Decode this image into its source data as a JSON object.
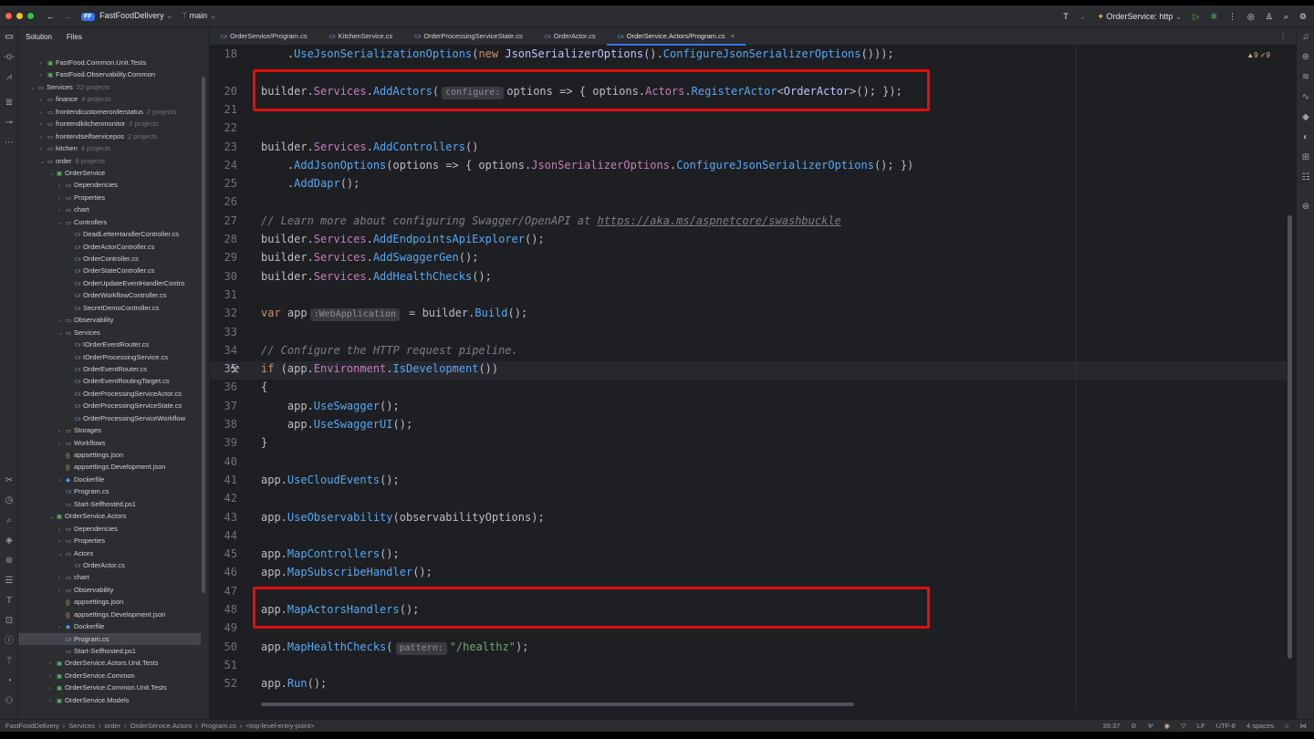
{
  "titlebar": {
    "project_badge": "FF",
    "project_name": "FastFoodDelivery",
    "branch": "main",
    "run_config": "OrderService: http"
  },
  "project_panel": {
    "tabs": [
      "Solution",
      "Files"
    ],
    "rows": [
      {
        "indent": 2,
        "chev": "›",
        "icon": "proj",
        "label": "FastFood.Common.Unit.Tests",
        "meta": ""
      },
      {
        "indent": 2,
        "chev": "›",
        "icon": "proj",
        "label": "FastFood.Observability.Common",
        "meta": ""
      },
      {
        "indent": 1,
        "chev": "⌄",
        "icon": "folder",
        "label": "Services",
        "meta": "22 projects"
      },
      {
        "indent": 2,
        "chev": "›",
        "icon": "folder",
        "label": "finance",
        "meta": "4 projects"
      },
      {
        "indent": 2,
        "chev": "›",
        "icon": "folder",
        "label": "frontendcustomerorderstatus",
        "meta": "2 projects"
      },
      {
        "indent": 2,
        "chev": "›",
        "icon": "folder",
        "label": "frontendkitchenmonitor",
        "meta": "2 projects"
      },
      {
        "indent": 2,
        "chev": "›",
        "icon": "folder",
        "label": "frontendselfservicepos",
        "meta": "2 projects"
      },
      {
        "indent": 2,
        "chev": "›",
        "icon": "folder",
        "label": "kitchen",
        "meta": "4 projects"
      },
      {
        "indent": 2,
        "chev": "⌄",
        "icon": "folder",
        "label": "order",
        "meta": "8 projects"
      },
      {
        "indent": 3,
        "chev": "⌄",
        "icon": "proj",
        "label": "OrderService",
        "meta": ""
      },
      {
        "indent": 4,
        "chev": "›",
        "icon": "folder",
        "label": "Dependencies",
        "meta": ""
      },
      {
        "indent": 4,
        "chev": "›",
        "icon": "folder",
        "label": "Properties",
        "meta": ""
      },
      {
        "indent": 4,
        "chev": "›",
        "icon": "folder",
        "label": "chart",
        "meta": ""
      },
      {
        "indent": 4,
        "chev": "⌄",
        "icon": "folder",
        "label": "Controllers",
        "meta": ""
      },
      {
        "indent": 5,
        "chev": "",
        "icon": "cs",
        "label": "DeadLetterHandlerController.cs",
        "meta": ""
      },
      {
        "indent": 5,
        "chev": "",
        "icon": "cs",
        "label": "OrderActorController.cs",
        "meta": ""
      },
      {
        "indent": 5,
        "chev": "",
        "icon": "cs",
        "label": "OrderController.cs",
        "meta": ""
      },
      {
        "indent": 5,
        "chev": "",
        "icon": "cs",
        "label": "OrderStateController.cs",
        "meta": ""
      },
      {
        "indent": 5,
        "chev": "",
        "icon": "cs",
        "label": "OrderUpdateEventHandlerContro",
        "meta": ""
      },
      {
        "indent": 5,
        "chev": "",
        "icon": "cs",
        "label": "OrderWorkflowController.cs",
        "meta": ""
      },
      {
        "indent": 5,
        "chev": "",
        "icon": "cs",
        "label": "SecretDemoController.cs",
        "meta": ""
      },
      {
        "indent": 4,
        "chev": "›",
        "icon": "folder",
        "label": "Observability",
        "meta": ""
      },
      {
        "indent": 4,
        "chev": "⌄",
        "icon": "folder",
        "label": "Services",
        "meta": ""
      },
      {
        "indent": 5,
        "chev": "",
        "icon": "cs",
        "label": "IOrderEventRouter.cs",
        "meta": ""
      },
      {
        "indent": 5,
        "chev": "",
        "icon": "cs",
        "label": "IOrderProcessingService.cs",
        "meta": ""
      },
      {
        "indent": 5,
        "chev": "",
        "icon": "cs",
        "label": "OrderEventRouter.cs",
        "meta": ""
      },
      {
        "indent": 5,
        "chev": "",
        "icon": "cs",
        "label": "OrderEventRoutingTarget.cs",
        "meta": ""
      },
      {
        "indent": 5,
        "chev": "",
        "icon": "cs",
        "label": "OrderProcessingServiceActor.cs",
        "meta": ""
      },
      {
        "indent": 5,
        "chev": "",
        "icon": "cs",
        "label": "OrderProcessingServiceState.cs",
        "meta": ""
      },
      {
        "indent": 5,
        "chev": "",
        "icon": "cs",
        "label": "OrderProcessingServiceWorkflow",
        "meta": ""
      },
      {
        "indent": 4,
        "chev": "›",
        "icon": "folder",
        "label": "Storages",
        "meta": ""
      },
      {
        "indent": 4,
        "chev": "›",
        "icon": "folder",
        "label": "Workflows",
        "meta": ""
      },
      {
        "indent": 4,
        "chev": "",
        "icon": "json",
        "label": "appsettings.json",
        "meta": ""
      },
      {
        "indent": 4,
        "chev": "",
        "icon": "json",
        "label": "appsettings.Development.json",
        "meta": ""
      },
      {
        "indent": 4,
        "chev": "›",
        "icon": "docker",
        "label": "Dockerfile",
        "meta": ""
      },
      {
        "indent": 4,
        "chev": "",
        "icon": "cs",
        "label": "Program.cs",
        "meta": ""
      },
      {
        "indent": 4,
        "chev": "",
        "icon": "folder",
        "label": "Start-Selfhosted.ps1",
        "meta": ""
      },
      {
        "indent": 3,
        "chev": "⌄",
        "icon": "proj",
        "label": "OrderService.Actors",
        "meta": ""
      },
      {
        "indent": 4,
        "chev": "›",
        "icon": "folder",
        "label": "Dependencies",
        "meta": ""
      },
      {
        "indent": 4,
        "chev": "›",
        "icon": "folder",
        "label": "Properties",
        "meta": ""
      },
      {
        "indent": 4,
        "chev": "⌄",
        "icon": "folder",
        "label": "Actors",
        "meta": ""
      },
      {
        "indent": 5,
        "chev": "",
        "icon": "cs",
        "label": "OrderActor.cs",
        "meta": ""
      },
      {
        "indent": 4,
        "chev": "›",
        "icon": "folder",
        "label": "chart",
        "meta": ""
      },
      {
        "indent": 4,
        "chev": "›",
        "icon": "folder",
        "label": "Observability",
        "meta": ""
      },
      {
        "indent": 4,
        "chev": "",
        "icon": "json",
        "label": "appsettings.json",
        "meta": ""
      },
      {
        "indent": 4,
        "chev": "",
        "icon": "json",
        "label": "appsettings.Development.json",
        "meta": ""
      },
      {
        "indent": 4,
        "chev": "›",
        "icon": "docker",
        "label": "Dockerfile",
        "meta": ""
      },
      {
        "indent": 4,
        "chev": "",
        "icon": "cs",
        "label": "Program.cs",
        "meta": "",
        "selected": true
      },
      {
        "indent": 4,
        "chev": "",
        "icon": "folder",
        "label": "Start-Selfhosted.ps1",
        "meta": ""
      },
      {
        "indent": 3,
        "chev": "›",
        "icon": "proj",
        "label": "OrderService.Actors.Unit.Tests",
        "meta": ""
      },
      {
        "indent": 3,
        "chev": "›",
        "icon": "proj",
        "label": "OrderService.Common",
        "meta": ""
      },
      {
        "indent": 3,
        "chev": "›",
        "icon": "proj",
        "label": "OrderService.Common.Unit.Tests",
        "meta": ""
      },
      {
        "indent": 3,
        "chev": "›",
        "icon": "proj",
        "label": "OrderService.Models",
        "meta": ""
      }
    ]
  },
  "editor_tabs": [
    {
      "label": "OrderService/Program.cs",
      "active": false
    },
    {
      "label": "KitchenService.cs",
      "active": false
    },
    {
      "label": "OrderProcessingServiceState.cs",
      "active": false
    },
    {
      "label": "OrderActor.cs",
      "active": false
    },
    {
      "label": "OrderService.Actors/Program.cs",
      "active": true
    }
  ],
  "editor": {
    "inspection": "▲9 ✓9",
    "current_line": 35,
    "lines": [
      {
        "n": 18,
        "html": "    .<span class='t-fn'>UseJsonSerializationOptions</span>(<span class='t-kw'>new</span> <span class='t-ty'>JsonSerializerOptions</span>().<span class='t-fn'>ConfigureJsonSerializerOptions</span>()));"
      },
      {
        "n": 20,
        "html": "builder.<span class='t-pr'>Services</span>.<span class='t-fn'>AddActors</span>(<span class='hint'>configure:</span>options =&gt; { options.<span class='t-pr'>Actors</span>.<span class='t-fn'>RegisterActor</span>&lt;<span class='t-ty'>OrderActor</span>&gt;(); });"
      },
      {
        "n": 21,
        "html": ""
      },
      {
        "n": 22,
        "html": ""
      },
      {
        "n": 23,
        "html": "builder.<span class='t-pr'>Services</span>.<span class='t-fn'>AddControllers</span>()"
      },
      {
        "n": 24,
        "html": "    .<span class='t-fn'>AddJsonOptions</span>(options =&gt; { options.<span class='t-pr'>JsonSerializerOptions</span>.<span class='t-fn'>ConfigureJsonSerializerOptions</span>(); })"
      },
      {
        "n": 25,
        "html": "    .<span class='t-fn'>AddDapr</span>();"
      },
      {
        "n": 26,
        "html": ""
      },
      {
        "n": 27,
        "html": "<span class='t-cm'>// Learn more about configuring Swagger/OpenAPI at </span><span class='t-link'>https://aka.ms/aspnetcore/swashbuckle</span>"
      },
      {
        "n": 28,
        "html": "builder.<span class='t-pr'>Services</span>.<span class='t-fn'>AddEndpointsApiExplorer</span>();"
      },
      {
        "n": 29,
        "html": "builder.<span class='t-pr'>Services</span>.<span class='t-fn'>AddSwaggerGen</span>();"
      },
      {
        "n": 30,
        "html": "builder.<span class='t-pr'>Services</span>.<span class='t-fn'>AddHealthChecks</span>();"
      },
      {
        "n": 31,
        "html": ""
      },
      {
        "n": 32,
        "html": "<span class='t-kw'>var</span> app<span class='hint'>:WebApplication</span> = builder.<span class='t-fn'>Build</span>();"
      },
      {
        "n": 33,
        "html": ""
      },
      {
        "n": 34,
        "html": "<span class='t-cm'>// Configure the HTTP request pipeline.</span>"
      },
      {
        "n": 35,
        "html": "<span class='t-kw'>if</span> (app.<span class='t-pr'>Environment</span>.<span class='t-fn'>IsDevelopment</span>())"
      },
      {
        "n": 36,
        "html": "{"
      },
      {
        "n": 37,
        "html": "    app.<span class='t-fn'>UseSwagger</span>();"
      },
      {
        "n": 38,
        "html": "    app.<span class='t-fn'>UseSwaggerUI</span>();"
      },
      {
        "n": 39,
        "html": "}"
      },
      {
        "n": 40,
        "html": ""
      },
      {
        "n": 41,
        "html": "app.<span class='t-fn'>UseCloudEvents</span>();"
      },
      {
        "n": 42,
        "html": ""
      },
      {
        "n": 43,
        "html": "app.<span class='t-fn'>UseObservability</span>(observabilityOptions);"
      },
      {
        "n": 44,
        "html": ""
      },
      {
        "n": 45,
        "html": "app.<span class='t-fn'>MapControllers</span>();"
      },
      {
        "n": 46,
        "html": "app.<span class='t-fn'>MapSubscribeHandler</span>();"
      },
      {
        "n": 47,
        "html": ""
      },
      {
        "n": 48,
        "html": "app.<span class='t-fn'>MapActorsHandlers</span>();"
      },
      {
        "n": 49,
        "html": ""
      },
      {
        "n": 50,
        "html": "app.<span class='t-fn'>MapHealthChecks</span>(<span class='hint'>pattern:</span><span class='t-str'>\"/healthz\"</span>);"
      },
      {
        "n": 51,
        "html": ""
      },
      {
        "n": 52,
        "html": "app.<span class='t-fn'>Run</span>();"
      }
    ]
  },
  "statusbar": {
    "crumbs": [
      "FastFoodDelivery",
      "Services",
      "order",
      "OrderService.Actors",
      "Program.cs",
      "<top-level-entry-point>"
    ],
    "position": "35:37",
    "line_ending": "LF",
    "encoding": "UTF-8",
    "indent": "4 spaces"
  },
  "colors": {
    "highlight_box": "#e00e0e",
    "accent": "#3574f0"
  }
}
